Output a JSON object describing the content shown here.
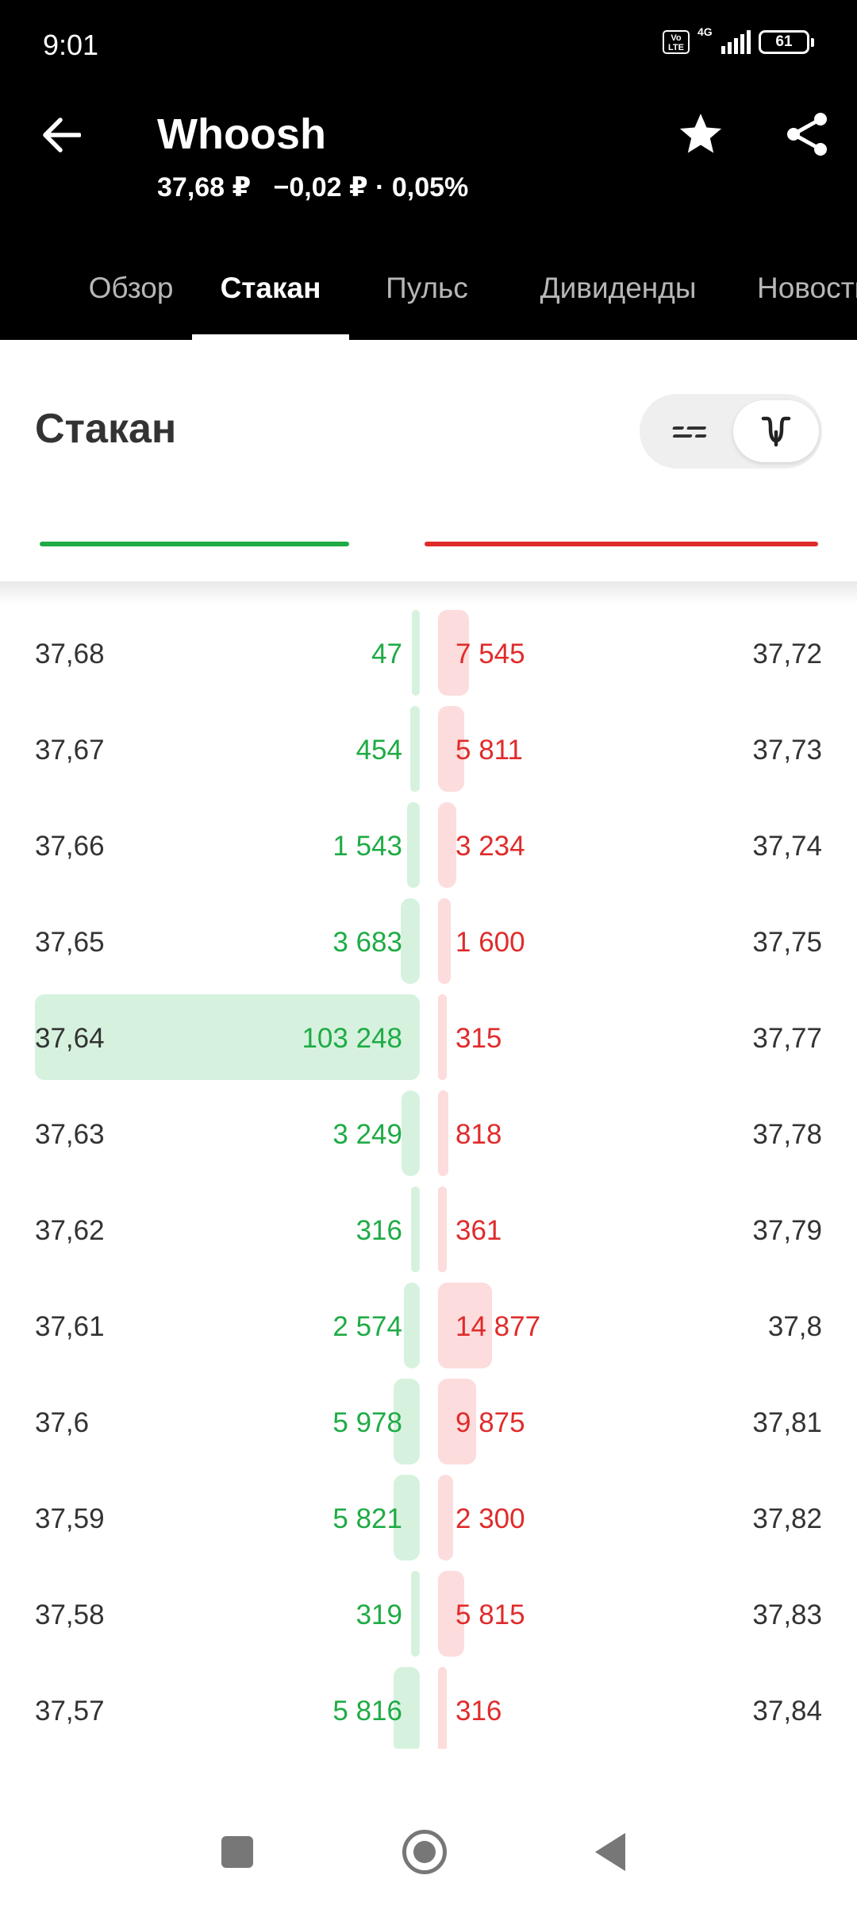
{
  "status": {
    "time": "9:01",
    "volte": "Vo LTE",
    "network": "4G",
    "battery": "61"
  },
  "header": {
    "title": "Whoosh",
    "price": "37,68 ₽",
    "change": "−0,02 ₽ · 0,05%"
  },
  "icons": {
    "back": "back-arrow-icon",
    "favorite": "star-icon",
    "share": "share-icon"
  },
  "tabs": [
    {
      "label": "Обзор",
      "active": false
    },
    {
      "label": "Стакан",
      "active": true
    },
    {
      "label": "Пульс",
      "active": false
    },
    {
      "label": "Дивиденды",
      "active": false
    },
    {
      "label": "Новости",
      "active": false
    }
  ],
  "section": {
    "title": "Стакан",
    "view_toggle": {
      "selected": "depth-view"
    }
  },
  "colors": {
    "bid": "#1fab45",
    "ask": "#e02b2b",
    "bid_bar": "#d6f2de",
    "ask_bar": "#fcdcdc"
  },
  "order_book": {
    "rows": [
      {
        "bid_price": "37,68",
        "bid_qty": "47",
        "bid_volume": 47,
        "ask_qty": "7 545",
        "ask_volume": 7545,
        "ask_price": "37,72"
      },
      {
        "bid_price": "37,67",
        "bid_qty": "454",
        "bid_volume": 454,
        "ask_qty": "5 811",
        "ask_volume": 5811,
        "ask_price": "37,73"
      },
      {
        "bid_price": "37,66",
        "bid_qty": "1 543",
        "bid_volume": 1543,
        "ask_qty": "3 234",
        "ask_volume": 3234,
        "ask_price": "37,74"
      },
      {
        "bid_price": "37,65",
        "bid_qty": "3 683",
        "bid_volume": 3683,
        "ask_qty": "1 600",
        "ask_volume": 1600,
        "ask_price": "37,75"
      },
      {
        "bid_price": "37,64",
        "bid_qty": "103 248",
        "bid_volume": 103248,
        "ask_qty": "315",
        "ask_volume": 315,
        "ask_price": "37,77"
      },
      {
        "bid_price": "37,63",
        "bid_qty": "3 249",
        "bid_volume": 3249,
        "ask_qty": "818",
        "ask_volume": 818,
        "ask_price": "37,78"
      },
      {
        "bid_price": "37,62",
        "bid_qty": "316",
        "bid_volume": 316,
        "ask_qty": "361",
        "ask_volume": 361,
        "ask_price": "37,79"
      },
      {
        "bid_price": "37,61",
        "bid_qty": "2 574",
        "bid_volume": 2574,
        "ask_qty": "14 877",
        "ask_volume": 14877,
        "ask_price": "37,8"
      },
      {
        "bid_price": "37,6",
        "bid_qty": "5 978",
        "bid_volume": 5978,
        "ask_qty": "9 875",
        "ask_volume": 9875,
        "ask_price": "37,81"
      },
      {
        "bid_price": "37,59",
        "bid_qty": "5 821",
        "bid_volume": 5821,
        "ask_qty": "2 300",
        "ask_volume": 2300,
        "ask_price": "37,82"
      },
      {
        "bid_price": "37,58",
        "bid_qty": "319",
        "bid_volume": 319,
        "ask_qty": "5 815",
        "ask_volume": 5815,
        "ask_price": "37,83"
      },
      {
        "bid_price": "37,57",
        "bid_qty": "5 816",
        "bid_volume": 5816,
        "ask_qty": "316",
        "ask_volume": 316,
        "ask_price": "37,84"
      }
    ]
  },
  "navbar": {
    "recents": "recents-square-icon",
    "home": "home-circle-icon",
    "back": "back-triangle-icon"
  }
}
